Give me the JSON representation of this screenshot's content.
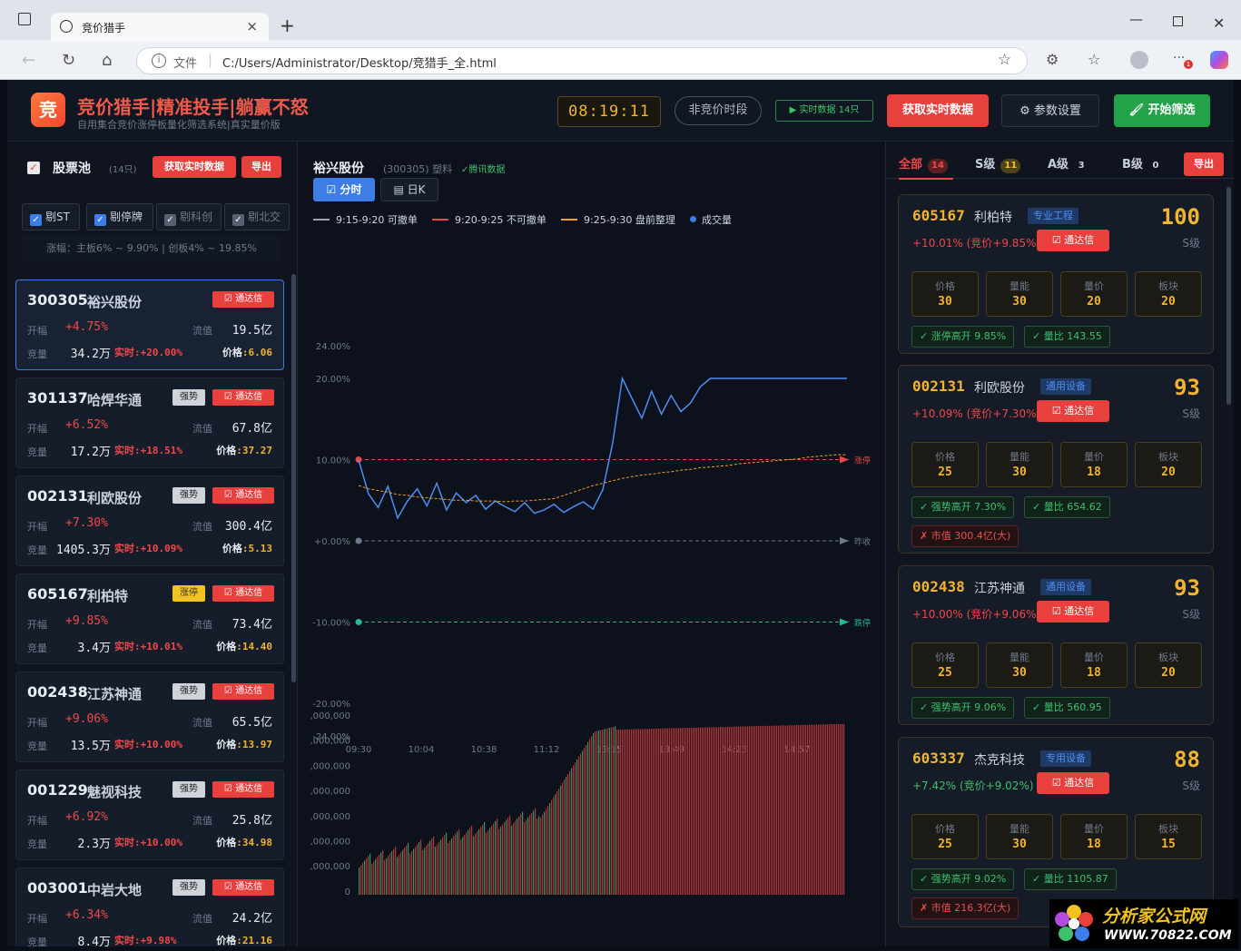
{
  "browser": {
    "tab_title": "竞价猎手",
    "address_prefix": "文件",
    "address": "C:/Users/Administrator/Desktop/竞猎手_全.html",
    "watermark": "分析家公式网www.70822.com"
  },
  "header": {
    "logo_char": "竞",
    "title": "竞价猎手|精准投手|躺赢不怒",
    "subtitle": "自用集合竞价涨停板量化筛选系统|真实量价版",
    "clock": "08:19:11",
    "phase": "非竞价时段",
    "realtime_tag": "实时数据 14只",
    "fetch_btn": "获取实时数据",
    "settings_btn": "参数设置",
    "start_btn": "开始筛选"
  },
  "pool": {
    "title": "股票池",
    "count": "(14只)",
    "fetch_btn": "获取实时数据",
    "export_btn": "导出",
    "filters": [
      {
        "label": "剔ST",
        "checked": true
      },
      {
        "label": "剔停牌",
        "checked": true
      },
      {
        "label": "剔科创",
        "checked": false
      },
      {
        "label": "剔北交",
        "checked": false
      }
    ],
    "range_info": "涨幅：主板6% ~ 9.90% | 创板4% ~ 19.85%",
    "labels": {
      "open": "开幅",
      "float": "流值",
      "vol": "竞量",
      "realtime": "实时",
      "price": "价格",
      "tdx": "通达信"
    },
    "stocks": [
      {
        "code": "300305",
        "name": "裕兴股份",
        "tag": "",
        "open": "+4.75%",
        "float": "19.5亿",
        "vol": "34.2万",
        "rt": ":+20.00%",
        "price": ":6.06",
        "selected": true
      },
      {
        "code": "301137",
        "name": "哈焊华通",
        "tag": "强势",
        "open": "+6.52%",
        "float": "67.8亿",
        "vol": "17.2万",
        "rt": ":+18.51%",
        "price": ":37.27"
      },
      {
        "code": "002131",
        "name": "利欧股份",
        "tag": "强势",
        "open": "+7.30%",
        "float": "300.4亿",
        "vol": "1405.3万",
        "rt": ":+10.09%",
        "price": ":5.13"
      },
      {
        "code": "605167",
        "name": "利柏特",
        "tag": "涨停",
        "open": "+9.85%",
        "float": "73.4亿",
        "vol": "3.4万",
        "rt": ":+10.01%",
        "price": ":14.40"
      },
      {
        "code": "002438",
        "name": "江苏神通",
        "tag": "强势",
        "open": "+9.06%",
        "float": "65.5亿",
        "vol": "13.5万",
        "rt": ":+10.00%",
        "price": ":13.97"
      },
      {
        "code": "001229",
        "name": "魅视科技",
        "tag": "强势",
        "open": "+6.92%",
        "float": "25.8亿",
        "vol": "2.3万",
        "rt": ":+10.00%",
        "price": ":34.98"
      },
      {
        "code": "003001",
        "name": "中岩大地",
        "tag": "强势",
        "open": "+6.34%",
        "float": "24.2亿",
        "vol": "8.4万",
        "rt": ":+9.98%",
        "price": ":21.16"
      }
    ]
  },
  "chart_panel": {
    "stock_name": "裕兴股份",
    "stock_meta": "(300305) 塑料",
    "source": "✓腾讯数据",
    "tab_intraday": "分时",
    "tab_daily": "日K",
    "legend": [
      "9:15-9:20 可撤单",
      "9:20-9:25 不可撤单",
      "9:25-9:30 盘前整理",
      "成交量"
    ],
    "legend_colors": [
      "#9aa4b4",
      "#e84848",
      "#f0a030",
      "#3c7de8"
    ],
    "ref_labels": [
      "涨停",
      "昨收",
      "跌停"
    ]
  },
  "chart_data": {
    "type": "line",
    "y_ticks": [
      "24.00%",
      "20.00%",
      "10.00%",
      "+0.00%",
      "-10.00%",
      "-20.00%",
      "-24.00%"
    ],
    "x_ticks": [
      "09:30",
      "10:04",
      "10:38",
      "11:12",
      "13:15",
      "13:49",
      "14:23",
      "14:57"
    ],
    "ylim": [
      -24,
      24
    ],
    "vol_ticks": [
      ",000,000",
      ",000,000",
      ",000,000",
      ",000,000",
      ",000,000",
      ",000,000",
      ",000,000",
      "0"
    ],
    "series": [
      {
        "values": [
          10.0,
          5.8,
          4.1,
          6.7,
          2.8,
          4.9,
          6.4,
          4.3,
          7.1,
          3.8,
          5.9,
          4.7,
          5.6,
          3.9,
          4.9,
          4.2,
          3.6,
          4.7,
          3.4,
          3.8,
          4.5,
          3.5,
          4.2,
          4.8,
          3.9,
          6.3,
          12.0,
          20.0,
          17.5,
          15.1,
          18.4,
          15.6,
          17.9,
          15.9,
          17.0,
          19.0,
          20.0,
          20.0,
          20.0,
          20.0,
          20.0,
          20.0,
          20.0,
          20.0,
          20.0,
          20.0,
          20.0,
          20.0,
          20.0,
          20.0,
          20.0
        ]
      },
      {
        "values": [
          6.8,
          6.4,
          6.2,
          6.0,
          5.7,
          5.6,
          5.4,
          5.3,
          5.2,
          5.1,
          5.0,
          5.0,
          4.9,
          4.9,
          4.9,
          4.8,
          4.9,
          4.9,
          5.0,
          5.1,
          5.2,
          5.6,
          6.0,
          6.4,
          6.8,
          7.1,
          7.4,
          7.7,
          7.9,
          8.1,
          8.2,
          8.4,
          8.5,
          8.7,
          8.8,
          9.0,
          9.1,
          9.2,
          9.3,
          9.5,
          9.6,
          9.7,
          9.8,
          9.9,
          10.0,
          10.1,
          10.3,
          10.4,
          10.5,
          10.6,
          10.6
        ]
      }
    ]
  },
  "signals": {
    "export_btn": "导出",
    "tabs": [
      {
        "label": "全部",
        "count": "14"
      },
      {
        "label": "S级",
        "count": "11"
      },
      {
        "label": "A级",
        "count": "3"
      },
      {
        "label": "B级",
        "count": "0"
      }
    ],
    "metric_names": [
      "价格",
      "量能",
      "量价",
      "板块"
    ],
    "tdx": "通达信",
    "cards": [
      {
        "code": "605167",
        "name": "利柏特",
        "industry": "专业工程",
        "score": "100",
        "level": "S级",
        "chg": "+10.01% (竞价+9.85%)",
        "metrics": [
          "30",
          "30",
          "20",
          "20"
        ],
        "tags": [
          "✓ 涨停高开 9.85%",
          "✓ 量比 143.55"
        ],
        "warn": ""
      },
      {
        "code": "002131",
        "name": "利欧股份",
        "industry": "通用设备",
        "score": "93",
        "level": "S级",
        "chg": "+10.09% (竞价+7.30%)",
        "metrics": [
          "25",
          "30",
          "18",
          "20"
        ],
        "tags": [
          "✓ 强势高开 7.30%",
          "✓ 量比 654.62"
        ],
        "warn": "✗ 市值 300.4亿(大)"
      },
      {
        "code": "002438",
        "name": "江苏神通",
        "industry": "通用设备",
        "score": "93",
        "level": "S级",
        "chg": "+10.00% (竞价+9.06%)",
        "metrics": [
          "25",
          "30",
          "18",
          "20"
        ],
        "tags": [
          "✓ 强势高开 9.06%",
          "✓ 量比 560.95"
        ],
        "warn": ""
      },
      {
        "code": "603337",
        "name": "杰克科技",
        "industry": "专用设备",
        "score": "88",
        "level": "S级",
        "chg": "+7.42% (竞价+9.02%)",
        "metrics": [
          "25",
          "30",
          "18",
          "15"
        ],
        "tags": [
          "✓ 强势高开 9.02%",
          "✓ 量比 1105.87"
        ],
        "warn": "✗ 市值 216.3亿(大)"
      }
    ]
  },
  "brand": {
    "line1": "分析家公式网",
    "line2": "WWW.70822.COM"
  }
}
